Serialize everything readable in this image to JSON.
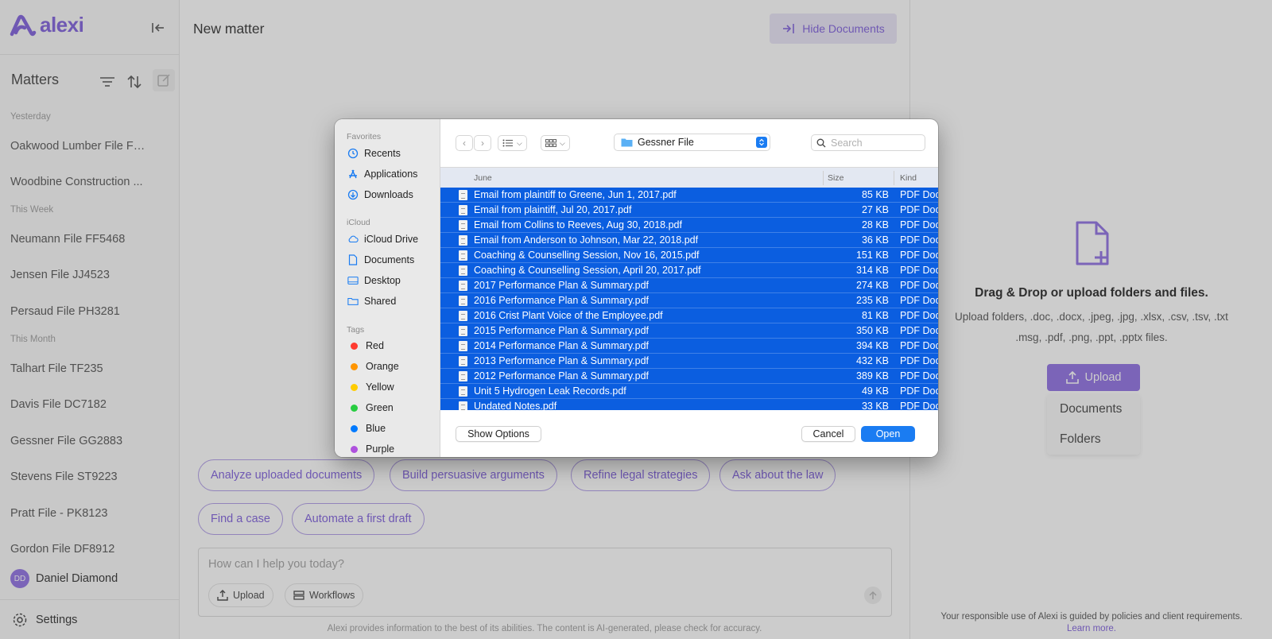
{
  "app": {
    "brand": "alexi",
    "page_title": "New matter",
    "hide_documents": "Hide Documents"
  },
  "sidebar": {
    "heading": "Matters",
    "groups": [
      {
        "label": "Yesterday",
        "items": [
          "Oakwood Lumber File FT...",
          "Woodbine Construction ..."
        ]
      },
      {
        "label": "This Week",
        "items": [
          "Neumann File FF5468",
          "Jensen File JJ4523",
          "Persaud File PH3281"
        ]
      },
      {
        "label": "This Month",
        "items": [
          "Talhart File TF235",
          "Davis File DC7182",
          "Gessner File GG2883",
          "Stevens File ST9223",
          "Pratt File - PK8123",
          "Gordon File DF8912"
        ]
      }
    ],
    "user": {
      "initials": "DD",
      "name": "Daniel Diamond"
    },
    "settings": "Settings"
  },
  "main": {
    "suggestions": [
      "Analyze uploaded documents",
      "Build persuasive arguments",
      "Refine legal strategies",
      "Ask about the law",
      "Find a case",
      "Automate a first draft"
    ],
    "composer": {
      "placeholder": "How can I help you today?",
      "upload": "Upload",
      "workflows": "Workflows"
    },
    "disclaimer": "Alexi provides information to the best of its abilities. The content is AI-generated, please check for accuracy."
  },
  "documents_panel": {
    "title": "Drag & Drop or upload folders and files.",
    "subtitle": "Upload folders, .doc, .docx, .jpeg, .jpg, .xlsx, .csv, .tsv, .txt .msg, .pdf, .png, .ppt, .pptx files.",
    "upload": "Upload",
    "menu": [
      "Documents",
      "Folders"
    ],
    "policy": "Your responsible use of Alexi is guided by policies and client requirements.",
    "learn_more": "Learn more."
  },
  "file_dialog": {
    "sidebar": {
      "favorites_label": "Favorites",
      "favorites": [
        {
          "label": "Recents",
          "icon": "clock-icon"
        },
        {
          "label": "Applications",
          "icon": "applications-icon"
        },
        {
          "label": "Downloads",
          "icon": "download-icon"
        }
      ],
      "icloud_label": "iCloud",
      "icloud": [
        {
          "label": "iCloud Drive",
          "icon": "cloud-icon"
        },
        {
          "label": "Documents",
          "icon": "document-icon"
        },
        {
          "label": "Desktop",
          "icon": "desktop-icon"
        },
        {
          "label": "Shared",
          "icon": "shared-folder-icon"
        }
      ],
      "tags_label": "Tags",
      "tags": [
        {
          "label": "Red",
          "color": "#ff3b30"
        },
        {
          "label": "Orange",
          "color": "#ff9500"
        },
        {
          "label": "Yellow",
          "color": "#ffcc00"
        },
        {
          "label": "Green",
          "color": "#28cd41"
        },
        {
          "label": "Blue",
          "color": "#007aff"
        },
        {
          "label": "Purple",
          "color": "#af52de"
        }
      ]
    },
    "location": "Gessner File",
    "search_placeholder": "Search",
    "columns": {
      "name": "June",
      "size": "Size",
      "kind": "Kind"
    },
    "files": [
      {
        "name": "Email from plaintiff to Greene, Jun 1, 2017.pdf",
        "size": "85 KB",
        "kind": "PDF Document"
      },
      {
        "name": "Email from plaintiff, Jul 20, 2017.pdf",
        "size": "27 KB",
        "kind": "PDF Document"
      },
      {
        "name": "Email from Collins to Reeves, Aug 30, 2018.pdf",
        "size": "28 KB",
        "kind": "PDF Document"
      },
      {
        "name": "Email from Anderson to Johnson, Mar 22, 2018.pdf",
        "size": "36 KB",
        "kind": "PDF Document"
      },
      {
        "name": "Coaching & Counselling Session, Nov 16, 2015.pdf",
        "size": "151 KB",
        "kind": "PDF Document"
      },
      {
        "name": "Coaching & Counselling Session, April 20, 2017.pdf",
        "size": "314 KB",
        "kind": "PDF Document"
      },
      {
        "name": "2017 Performance Plan & Summary.pdf",
        "size": "274 KB",
        "kind": "PDF Document"
      },
      {
        "name": "2016 Performance Plan & Summary.pdf",
        "size": "235 KB",
        "kind": "PDF Document"
      },
      {
        "name": "2016 Crist Plant Voice of the Employee.pdf",
        "size": "81 KB",
        "kind": "PDF Document"
      },
      {
        "name": "2015 Performance Plan & Summary.pdf",
        "size": "350 KB",
        "kind": "PDF Document"
      },
      {
        "name": "2014 Performance Plan & Summary.pdf",
        "size": "394 KB",
        "kind": "PDF Document"
      },
      {
        "name": "2013 Performance Plan & Summary.pdf",
        "size": "432 KB",
        "kind": "PDF Document"
      },
      {
        "name": "2012 Performance Plan & Summary.pdf",
        "size": "389 KB",
        "kind": "PDF Document"
      },
      {
        "name": "Unit 5 Hydrogen Leak Records.pdf",
        "size": "49 KB",
        "kind": "PDF Document"
      },
      {
        "name": "Undated Notes.pdf",
        "size": "33 KB",
        "kind": "PDF Document"
      }
    ],
    "show_options": "Show Options",
    "cancel": "Cancel",
    "open": "Open"
  },
  "colors": {
    "accent": "#8b6fe0",
    "selection": "#0b5ee0",
    "mac_blue": "#1a7cf2"
  }
}
